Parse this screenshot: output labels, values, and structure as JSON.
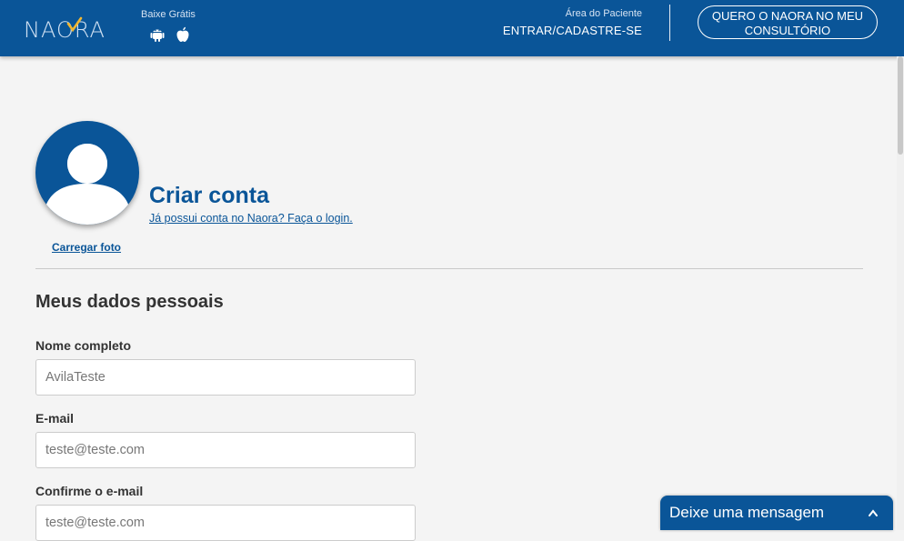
{
  "header": {
    "logo_text": "NAORA",
    "download_label": "Baixe Grátis",
    "android_icon": "android-icon",
    "apple_icon": "apple-icon",
    "patient_area_label": "Área do Paciente",
    "login_link": "ENTRAR/CADASTRE-SE",
    "clinic_button": "QUERO O NAORA NO MEU CONSULTÓRIO",
    "background_color": "#0a5598",
    "logo_check_color": "#f2b731"
  },
  "profile": {
    "avatar_icon": "user-avatar-icon",
    "upload_photo": "Carregar foto",
    "title": "Criar conta",
    "login_prompt": "Já possui conta no Naora? Faça o login."
  },
  "personal_data": {
    "section_title": "Meus dados pessoais",
    "fields": [
      {
        "label": "Nome completo",
        "value": "AvilaTeste"
      },
      {
        "label": "E-mail",
        "value": "teste@teste.com"
      },
      {
        "label": "Confirme o e-mail",
        "value": "teste@teste.com"
      }
    ]
  },
  "chat": {
    "label": "Deixe uma mensagem",
    "icon": "chevron-up-icon"
  }
}
